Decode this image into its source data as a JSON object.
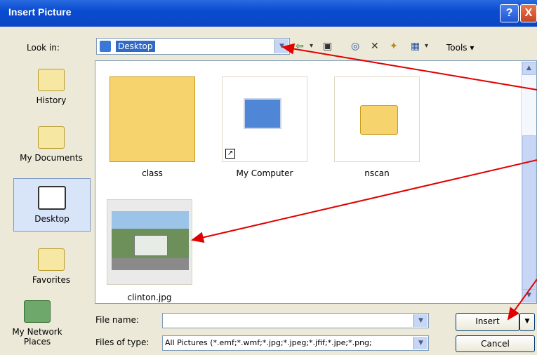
{
  "window": {
    "title": "Insert Picture"
  },
  "titlebar": {
    "help_glyph": "?",
    "close_glyph": "X"
  },
  "lookin": {
    "label": "Look in:",
    "value": "Desktop"
  },
  "toolbar": {
    "tools_label": "Tools",
    "back_glyph": "⇦",
    "delete_glyph": "✕",
    "dropdown_glyph": "▾"
  },
  "places": [
    {
      "label": "History",
      "icon": "history-icon"
    },
    {
      "label": "My Documents",
      "icon": "documents-icon"
    },
    {
      "label": "Desktop",
      "icon": "desktop-icon"
    },
    {
      "label": "Favorites",
      "icon": "favorites-icon"
    },
    {
      "label": "My Network Places",
      "icon": "network-icon"
    }
  ],
  "files": [
    {
      "name": "class",
      "type": "folder"
    },
    {
      "name": "My Computer",
      "type": "shortcut"
    },
    {
      "name": "nscan",
      "type": "folder"
    },
    {
      "name": "clinton.jpg",
      "type": "image"
    }
  ],
  "filename": {
    "label": "File name:",
    "value": ""
  },
  "filetype": {
    "label": "Files of type:",
    "value": "All Pictures (*.emf;*.wmf;*.jpg;*.jpeg;*.jfif;*.jpe;*.png;"
  },
  "buttons": {
    "insert": "Insert",
    "cancel": "Cancel"
  },
  "colors": {
    "titlebar": "#0b46c4",
    "selection": "#316ac5",
    "arrow": "#e00000"
  }
}
